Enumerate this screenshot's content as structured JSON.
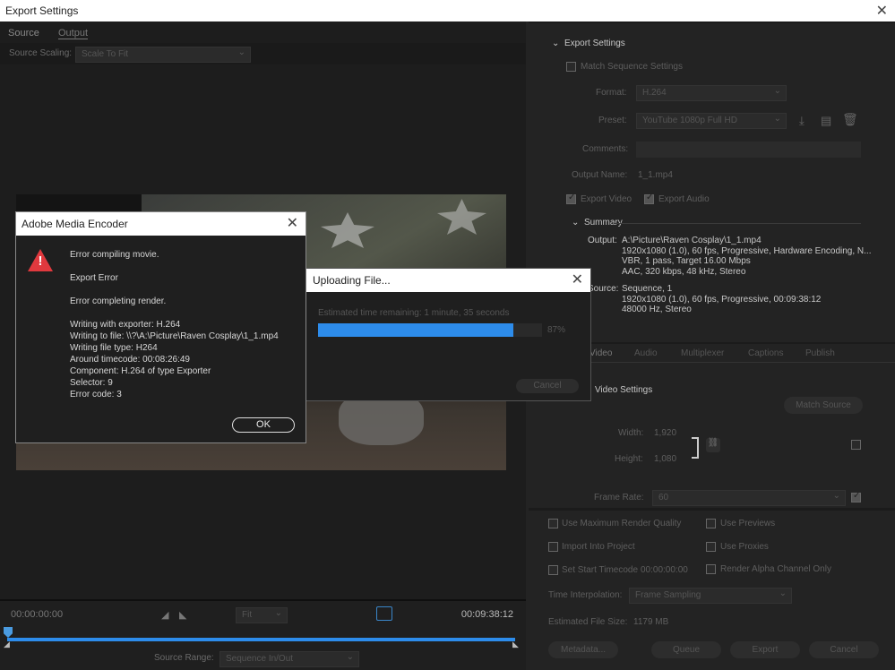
{
  "window": {
    "title": "Export Settings",
    "close": "✕"
  },
  "left": {
    "tabs": [
      {
        "label": "Source"
      },
      {
        "label": "Output"
      }
    ],
    "source_scaling_label": "Source Scaling:",
    "source_scaling_value": "Scale To Fit",
    "timecode_start": "00:00:00:00",
    "timecode_end": "00:09:38:12",
    "fit_value": "Fit",
    "source_range_label": "Source Range:",
    "source_range_value": "Sequence In/Out"
  },
  "export_settings": {
    "header": "Export Settings",
    "match_sequence": "Match Sequence Settings",
    "format_label": "Format:",
    "format_value": "H.264",
    "preset_label": "Preset:",
    "preset_value": "YouTube 1080p Full HD",
    "comments_label": "Comments:",
    "output_name_label": "Output Name:",
    "output_name_value": "1_1.mp4",
    "export_video": "Export Video",
    "export_audio": "Export Audio",
    "summary_header": "Summary",
    "output_label": "Output:",
    "output_lines": [
      "A:\\Picture\\Raven Cosplay\\1_1.mp4",
      "1920x1080 (1.0), 60 fps, Progressive, Hardware Encoding, N...",
      "VBR, 1 pass, Target 16.00 Mbps",
      "AAC, 320 kbps, 48 kHz, Stereo"
    ],
    "source_label": "Source:",
    "source_lines": [
      "Sequence, 1",
      "1920x1080 (1.0), 60 fps, Progressive, 00:09:38:12",
      "48000 Hz, Stereo"
    ]
  },
  "tabs2": [
    {
      "label": "Video"
    },
    {
      "label": "Audio"
    },
    {
      "label": "Multiplexer"
    },
    {
      "label": "Captions"
    },
    {
      "label": "Publish"
    }
  ],
  "video_settings": {
    "header": "Video Settings",
    "match_source": "Match Source",
    "width_label": "Width:",
    "width_value": "1,920",
    "height_label": "Height:",
    "height_value": "1,080",
    "frame_rate_label": "Frame Rate:",
    "frame_rate_value": "60"
  },
  "bottom": {
    "use_max_render": "Use Maximum Render Quality",
    "use_previews": "Use Previews",
    "import_into_project": "Import Into Project",
    "use_proxies": "Use Proxies",
    "set_start_timecode": "Set Start Timecode",
    "start_timecode_value": "00:00:00:00",
    "render_alpha": "Render Alpha Channel Only",
    "time_interp_label": "Time Interpolation:",
    "time_interp_value": "Frame Sampling",
    "est_size_label": "Estimated File Size:",
    "est_size_value": "1179 MB",
    "metadata": "Metadata...",
    "queue": "Queue",
    "export": "Export",
    "cancel": "Cancel"
  },
  "error_dialog": {
    "title": "Adobe Media Encoder",
    "lines": [
      "Error compiling movie.",
      "",
      "Export Error",
      "",
      "Error completing render.",
      "",
      "Writing with exporter: H.264",
      "Writing to file: \\\\?\\A:\\Picture\\Raven Cosplay\\1_1.mp4",
      "Writing file type: H264",
      "Around timecode: 00:08:26:49",
      "Component: H.264 of type Exporter",
      "Selector: 9",
      "Error code: 3"
    ],
    "ok": "OK"
  },
  "upload_dialog": {
    "title": "Uploading File...",
    "estimate": "Estimated time remaining: 1 minute, 35 seconds",
    "percent_text": "87%",
    "progress": 0.87,
    "cancel": "Cancel"
  },
  "colors": {
    "accent": "#2d8ceb",
    "error": "#e0393e"
  }
}
